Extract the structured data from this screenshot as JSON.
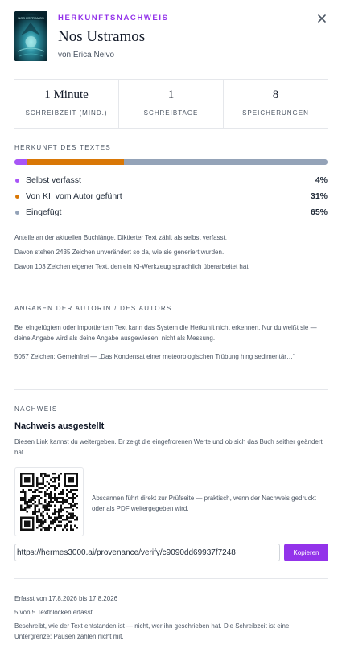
{
  "header": {
    "eyebrow": "HERKUNFTSNACHWEIS",
    "title": "Nos Ustramos",
    "author": "von Erica Neivo",
    "cover_text": "NOS USTRAMOS",
    "close_icon": "close-icon"
  },
  "stats": [
    {
      "value": "1 Minute",
      "label": "SCHREIBZEIT (MIND.)"
    },
    {
      "value": "1",
      "label": "SCHREIBTAGE"
    },
    {
      "value": "8",
      "label": "SPEICHERUNGEN"
    }
  ],
  "origin": {
    "heading": "HERKUNFT DES TEXTES",
    "items": [
      {
        "label": "Selbst verfasst",
        "percent": "4%",
        "value": 4,
        "color": "#a855f7"
      },
      {
        "label": "Von KI, vom Autor geführt",
        "percent": "31%",
        "value": 31,
        "color": "#d97706"
      },
      {
        "label": "Eingefügt",
        "percent": "65%",
        "value": 65,
        "color": "#94a3b8"
      }
    ],
    "note1": "Anteile an der aktuellen Buchlänge. Diktierter Text zählt als selbst verfasst.",
    "note2": "Davon stehen 2435 Zeichen unverändert so da, wie sie generiert wurden.",
    "note3": "Davon 103 Zeichen eigener Text, den ein KI-Werkzeug sprachlich überarbeitet hat."
  },
  "author_info": {
    "heading": "ANGABEN DER AUTORIN / DES AUTORS",
    "text": "Bei eingefügtem oder importiertem Text kann das System die Herkunft nicht erkennen. Nur du weißt sie — deine Angabe wird als deine Angabe ausgewiesen, nicht als Messung.",
    "entry": "5057 Zeichen: Gemeinfrei — „Das Kondensat einer meteorologischen Trübung hing sedimentär…“"
  },
  "proof": {
    "heading": "NACHWEIS",
    "subheading": "Nachweis ausgestellt",
    "text": "Diesen Link kannst du weitergeben. Er zeigt die eingefrorenen Werte und ob sich das Buch seither geändert hat.",
    "qr_note": "Abscannen führt direkt zur Prüfseite — praktisch, wenn der Nachweis gedruckt oder als PDF weitergegeben wird.",
    "url": "https://hermes3000.ai/provenance/verify/c9090dd69937f7248",
    "copy_label": "Kopieren"
  },
  "footer": {
    "captured": "Erfasst von 17.8.2026 bis 17.8.2026",
    "blocks": "5 von 5 Textblöcken erfasst",
    "disclaimer": "Beschreibt, wie der Text entstanden ist — nicht, wer ihn geschrieben hat. Die Schreibzeit ist eine Untergrenze: Pausen zählen nicht mit."
  }
}
